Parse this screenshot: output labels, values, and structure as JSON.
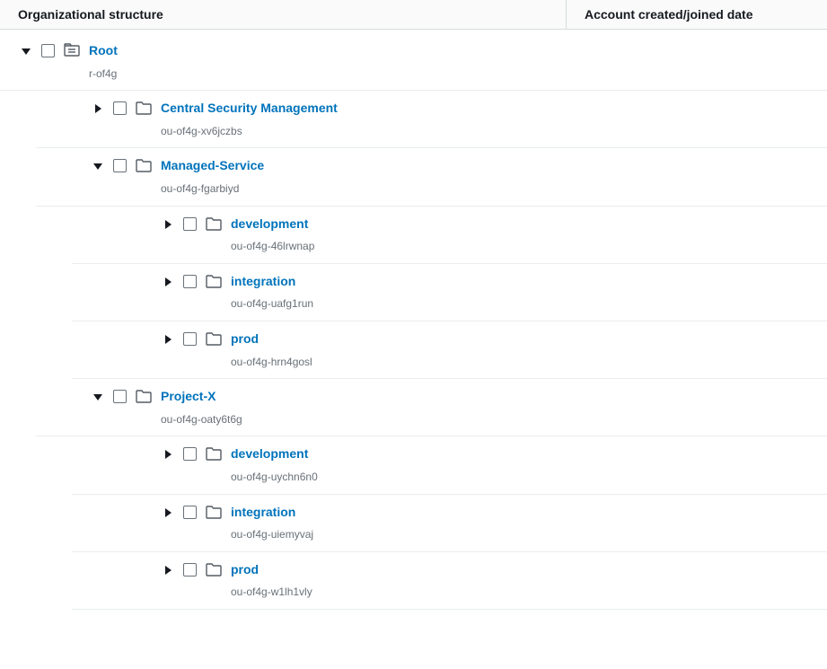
{
  "columns": {
    "name": "Organizational structure",
    "date": "Account created/joined date"
  },
  "tree": {
    "root": {
      "name": "Root",
      "id": "r-of4g"
    },
    "centralSecurity": {
      "name": "Central Security Management",
      "id": "ou-of4g-xv6jczbs"
    },
    "managedService": {
      "name": "Managed-Service",
      "id": "ou-of4g-fgarbiyd",
      "children": {
        "dev": {
          "name": "development",
          "id": "ou-of4g-46lrwnap"
        },
        "int": {
          "name": "integration",
          "id": "ou-of4g-uafg1run"
        },
        "prod": {
          "name": "prod",
          "id": "ou-of4g-hrn4gosl"
        }
      }
    },
    "projectX": {
      "name": "Project-X",
      "id": "ou-of4g-oaty6t6g",
      "children": {
        "dev": {
          "name": "development",
          "id": "ou-of4g-uychn6n0"
        },
        "int": {
          "name": "integration",
          "id": "ou-of4g-uiemyvaj"
        },
        "prod": {
          "name": "prod",
          "id": "ou-of4g-w1lh1vly"
        }
      }
    }
  }
}
